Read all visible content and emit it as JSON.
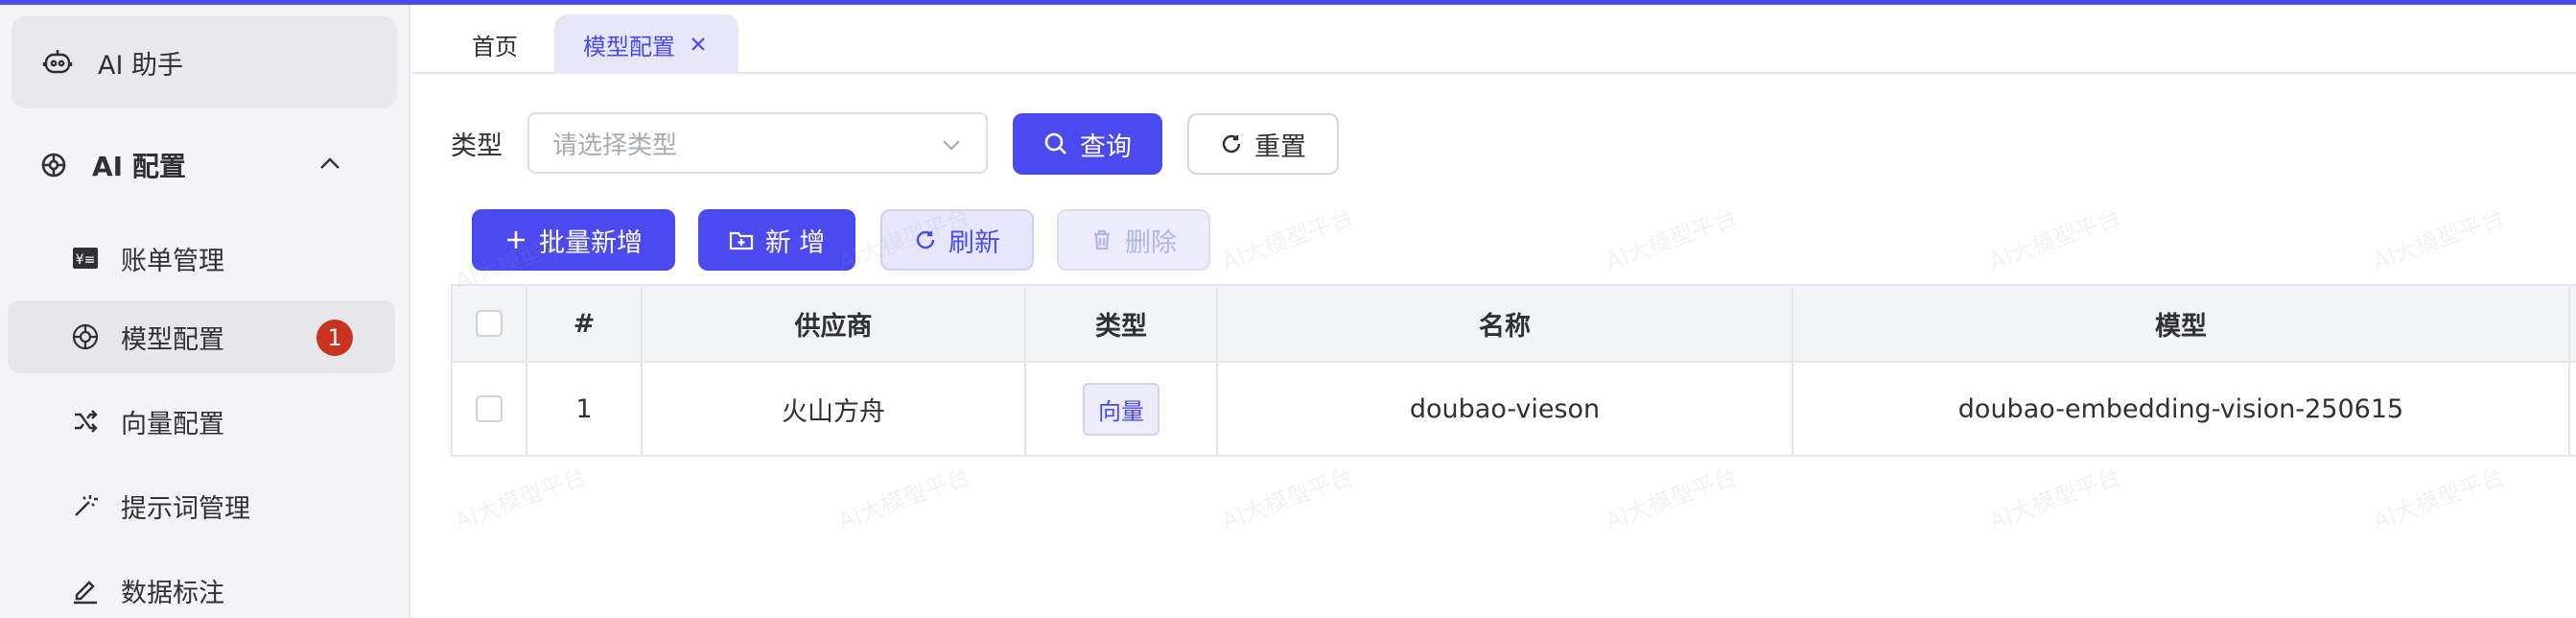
{
  "app": {
    "accent_color": "#4b49f0",
    "badge_color": "#c8321e"
  },
  "sidebar": {
    "assistant": {
      "label": "AI 助手",
      "icon": "robot-icon"
    },
    "group": {
      "label": "AI 配置",
      "icon": "ai-chip-icon",
      "expanded": true
    },
    "items": [
      {
        "label": "账单管理",
        "icon": "bill-icon",
        "active": false
      },
      {
        "label": "模型配置",
        "icon": "model-icon",
        "active": true,
        "badge": "1"
      },
      {
        "label": "向量配置",
        "icon": "shuffle-icon",
        "active": false
      },
      {
        "label": "提示词管理",
        "icon": "wand-icon",
        "active": false
      },
      {
        "label": "数据标注",
        "icon": "edit-icon",
        "active": false
      }
    ]
  },
  "tabs": {
    "home": "首页",
    "active": "模型配置"
  },
  "filter": {
    "type_label": "类型",
    "type_placeholder": "请选择类型",
    "query_label": "查询",
    "reset_label": "重置"
  },
  "toolbar": {
    "batch_add": "批量新增",
    "add": "新 增",
    "refresh": "刷新",
    "delete": "删除"
  },
  "table": {
    "columns": [
      "#",
      "供应商",
      "类型",
      "名称",
      "模型"
    ],
    "rows": [
      {
        "index": "1",
        "provider": "火山方舟",
        "type": "向量",
        "name": "doubao-vieson",
        "model": "doubao-embedding-vision-250615"
      }
    ]
  },
  "watermark": "AI大模型平台"
}
